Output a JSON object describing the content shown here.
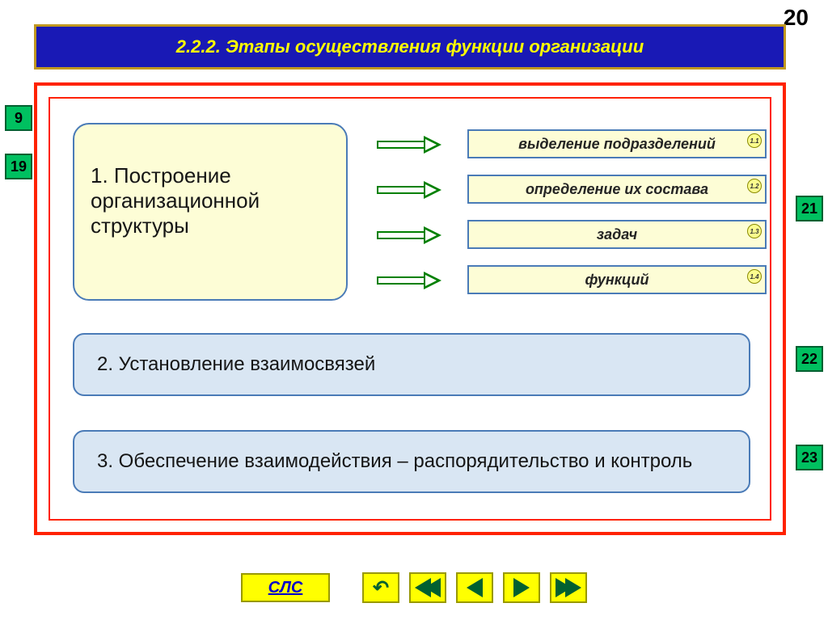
{
  "page_number": "20",
  "title": "2.2.2. Этапы осуществления функции организации",
  "block1": {
    "text": "1. Построение организационной структуры",
    "subs": [
      {
        "label": "выделение подразделений",
        "badge": "1.1"
      },
      {
        "label": "определение их состава",
        "badge": "1.2"
      },
      {
        "label": "задач",
        "badge": "1.3"
      },
      {
        "label": "функций",
        "badge": "1.4"
      }
    ]
  },
  "block2": "2. Установление взаимосвязей",
  "block3": "3. Обеспечение взаимодействия – распорядительство и контроль",
  "side_nav": {
    "left": [
      "9",
      "19"
    ],
    "right": [
      "21",
      "22",
      "23"
    ]
  },
  "footer": {
    "sls": "СЛС"
  }
}
